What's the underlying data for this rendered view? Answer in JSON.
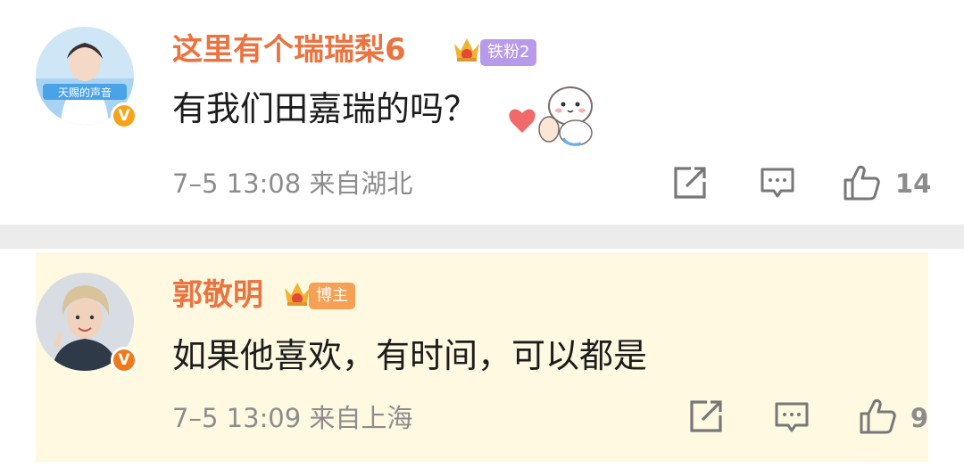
{
  "comments": [
    {
      "username": "这里有个瑞瑞梨6",
      "badge": "铁粉2",
      "text": "有我们田嘉瑞的吗？",
      "meta": "7–5 13:08  来自湖北",
      "likes": "14",
      "verified": "V",
      "avatar_text": "天赐的声音",
      "icons": [
        "crown-icon",
        "heart-sticker",
        "share-icon",
        "reply-icon",
        "like-icon"
      ]
    },
    {
      "username": "郭敬明",
      "badge": "博主",
      "text": "如果他喜欢，有时间，可以都是",
      "meta": "7–5 13:09  来自上海",
      "likes": "9",
      "verified": "V",
      "icons": [
        "crown-icon",
        "share-icon",
        "reply-icon",
        "like-icon"
      ]
    }
  ],
  "colors": {
    "username": "#eb7340",
    "badge_fan": "#b79bea",
    "badge_blogger": "#f4a155",
    "highlight_bg": "#fff9e2",
    "meta_gray": "#8c8c8c",
    "verified": "#f7a31a"
  }
}
